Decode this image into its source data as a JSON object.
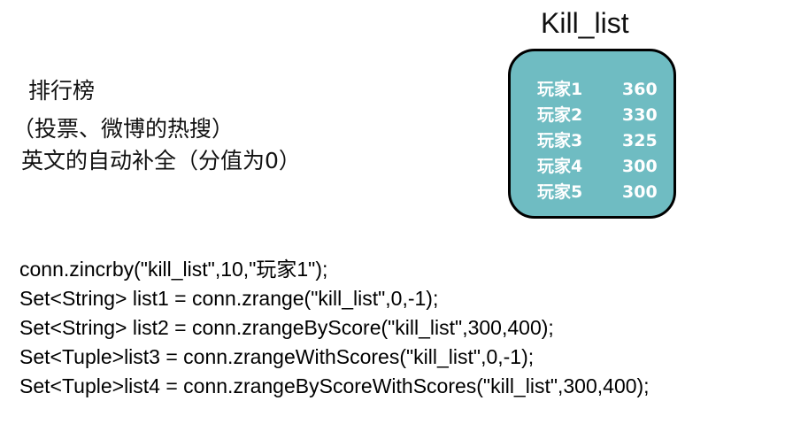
{
  "set_title": "Kill_list",
  "entries": [
    {
      "member": "玩家1",
      "score": "360"
    },
    {
      "member": "玩家2",
      "score": "330"
    },
    {
      "member": "玩家3",
      "score": "325"
    },
    {
      "member": "玩家4",
      "score": "300"
    },
    {
      "member": "玩家5",
      "score": "300"
    }
  ],
  "description": {
    "line1": "排行榜",
    "line2": "（投票、微博的热搜）",
    "line3": "英文的自动补全（分值为0）"
  },
  "code_lines": [
    "conn.zincrby(\"kill_list\",10,\"玩家1\");",
    "Set<String> list1 = conn.zrange(\"kill_list\",0,-1);",
    "Set<String> list2 = conn.zrangeByScore(\"kill_list\",300,400);",
    "Set<Tuple>list3 = conn.zrangeWithScores(\"kill_list\",0,-1);",
    "Set<Tuple>list4 = conn.zrangeByScoreWithScores(\"kill_list\",300,400);"
  ],
  "colors": {
    "box_fill": "#6fbcc2",
    "box_border": "#000000",
    "box_text": "#ffffff"
  }
}
